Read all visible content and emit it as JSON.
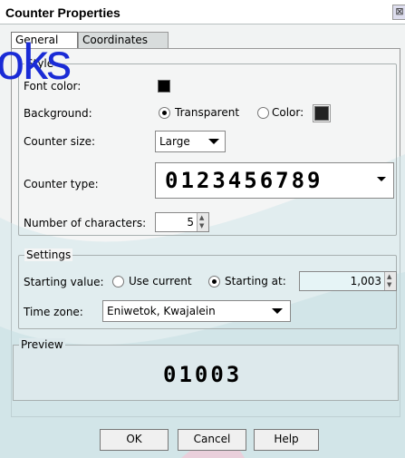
{
  "window": {
    "title": "Counter Properties",
    "close_glyph": "⊠"
  },
  "tabs": [
    {
      "label": "General"
    },
    {
      "label": "Coordinates"
    }
  ],
  "style": {
    "legend": "Style",
    "font_color_label": "Font color:",
    "background_label": "Background:",
    "transparent_label": "Transparent",
    "color_label": "Color:",
    "counter_size_label": "Counter size:",
    "counter_size_value": "Large",
    "counter_type_label": "Counter type:",
    "counter_type_value": "0123456789",
    "num_chars_label": "Number of characters:",
    "num_chars_value": "5"
  },
  "settings": {
    "legend": "Settings",
    "starting_value_label": "Starting value:",
    "use_current_label": "Use current",
    "starting_at_label": "Starting at:",
    "starting_at_value": "1,003",
    "time_zone_label": "Time zone:",
    "time_zone_value": "Eniwetok, Kwajalein"
  },
  "preview": {
    "legend": "Preview",
    "value": "01003"
  },
  "buttons": {
    "ok": "OK",
    "cancel": "Cancel",
    "help": "Help"
  },
  "overlay": {
    "text": "oks"
  }
}
